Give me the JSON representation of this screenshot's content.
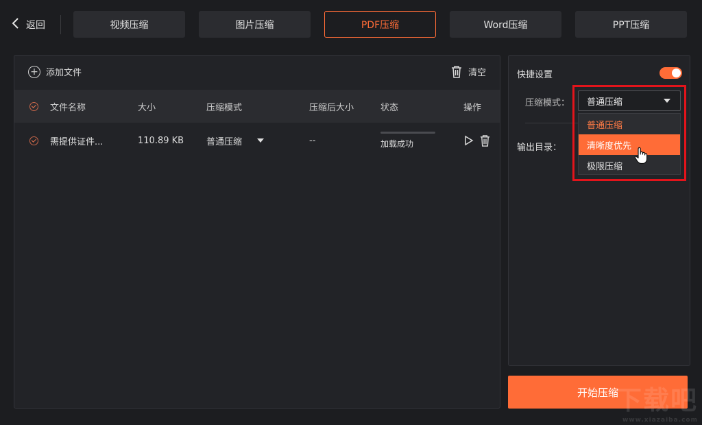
{
  "header": {
    "back_label": "返回",
    "tabs": [
      {
        "label": "视频压缩"
      },
      {
        "label": "图片压缩"
      },
      {
        "label": "PDF压缩"
      },
      {
        "label": "Word压缩"
      },
      {
        "label": "PPT压缩"
      }
    ]
  },
  "file_panel": {
    "add_file_label": "添加文件",
    "clear_label": "清空",
    "columns": {
      "name": "文件名称",
      "size": "大小",
      "mode": "压缩模式",
      "compressed_size": "压缩后大小",
      "status": "状态",
      "actions": "操作"
    },
    "rows": [
      {
        "name": "需提供证件...",
        "size": "110.89 KB",
        "mode": "普通压缩",
        "compressed_size": "--",
        "status": "加载成功",
        "progress": 1.0
      }
    ]
  },
  "settings": {
    "quick_label": "快捷设置",
    "quick_enabled": true,
    "mode_label": "压缩模式：",
    "mode_value": "普通压缩",
    "mode_options": [
      "普通压缩",
      "清晰度优先",
      "极限压缩"
    ],
    "hovered_option": "清晰度优先",
    "output_label": "输出目录："
  },
  "start_button_label": "开始压缩",
  "watermark": {
    "text": "下载吧",
    "sub": "www.xiazaiba.com"
  },
  "colors": {
    "accent": "#ff6c37",
    "highlight": "#e3141b"
  }
}
